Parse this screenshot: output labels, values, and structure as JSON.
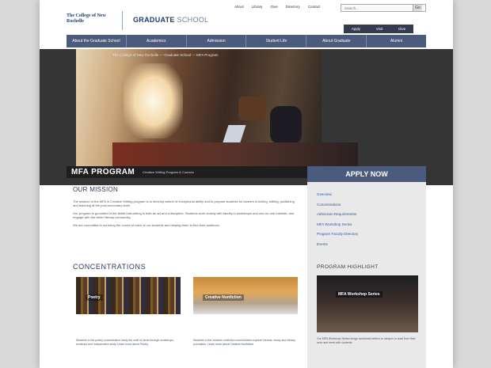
{
  "header": {
    "logo_text": "The College of New Rochelle",
    "school_name": "GRADUATE",
    "school_name_suffix": "SCHOOL"
  },
  "utility_links": [
    "About",
    "Library",
    "Give",
    "Directory",
    "Contact"
  ],
  "search": {
    "placeholder": "Search...",
    "button": "Go"
  },
  "give_bar": {
    "links": [
      "Apply",
      "Visit",
      "Give"
    ]
  },
  "nav": {
    "items": [
      "About the Graduate School",
      "Academics",
      "Admission",
      "Student Life",
      "About Graduate",
      "Alumni"
    ]
  },
  "hero": {
    "caption": "The College of New Rochelle — Graduate School — MFA Program"
  },
  "mfa": {
    "title": "MFA PROGRAM",
    "subtitle": "Creative Writing Program & Courses"
  },
  "apply": {
    "label": "APPLY NOW"
  },
  "mission": {
    "heading": "OUR MISSION",
    "paragraphs": [
      "The mission of the MFA in Creative Writing program is to develop writers of exceptional ability and to prepare students for careers in writing, editing, publishing and teaching at the post-secondary level.",
      "Our program is grounded in the belief that writing is both an art and a discipline. Students work closely with faculty in workshops and one-on-one tutorials, and engage with the wider literary community.",
      "We are committed to nurturing the voices of each of our students and helping them to find their audience."
    ]
  },
  "concentrations": {
    "heading": "CONCENTRATIONS",
    "cards": [
      {
        "label": "Poetry",
        "desc": "Students in the poetry concentration study the craft of verse through workshops, seminars and independent study.",
        "link": "Learn more about Poetry"
      },
      {
        "label": "Creative Nonfiction",
        "desc": "Students in the creative nonfiction concentration explore memoir, essay and literary journalism.",
        "link": "Learn more about Creative Nonfiction"
      }
    ]
  },
  "sidebar": {
    "links": [
      "Overview",
      "Concentrations",
      "Admission Requirements",
      "MFA Workshop Series",
      "Program Faculty Directory",
      "Events"
    ],
    "highlight_heading": "PROGRAM HIGHLIGHT",
    "highlight_caption": "MFA Workshop Series",
    "highlight_desc": "Our MFA Workshop Series brings acclaimed writers to campus to read from their work and meet with students."
  }
}
